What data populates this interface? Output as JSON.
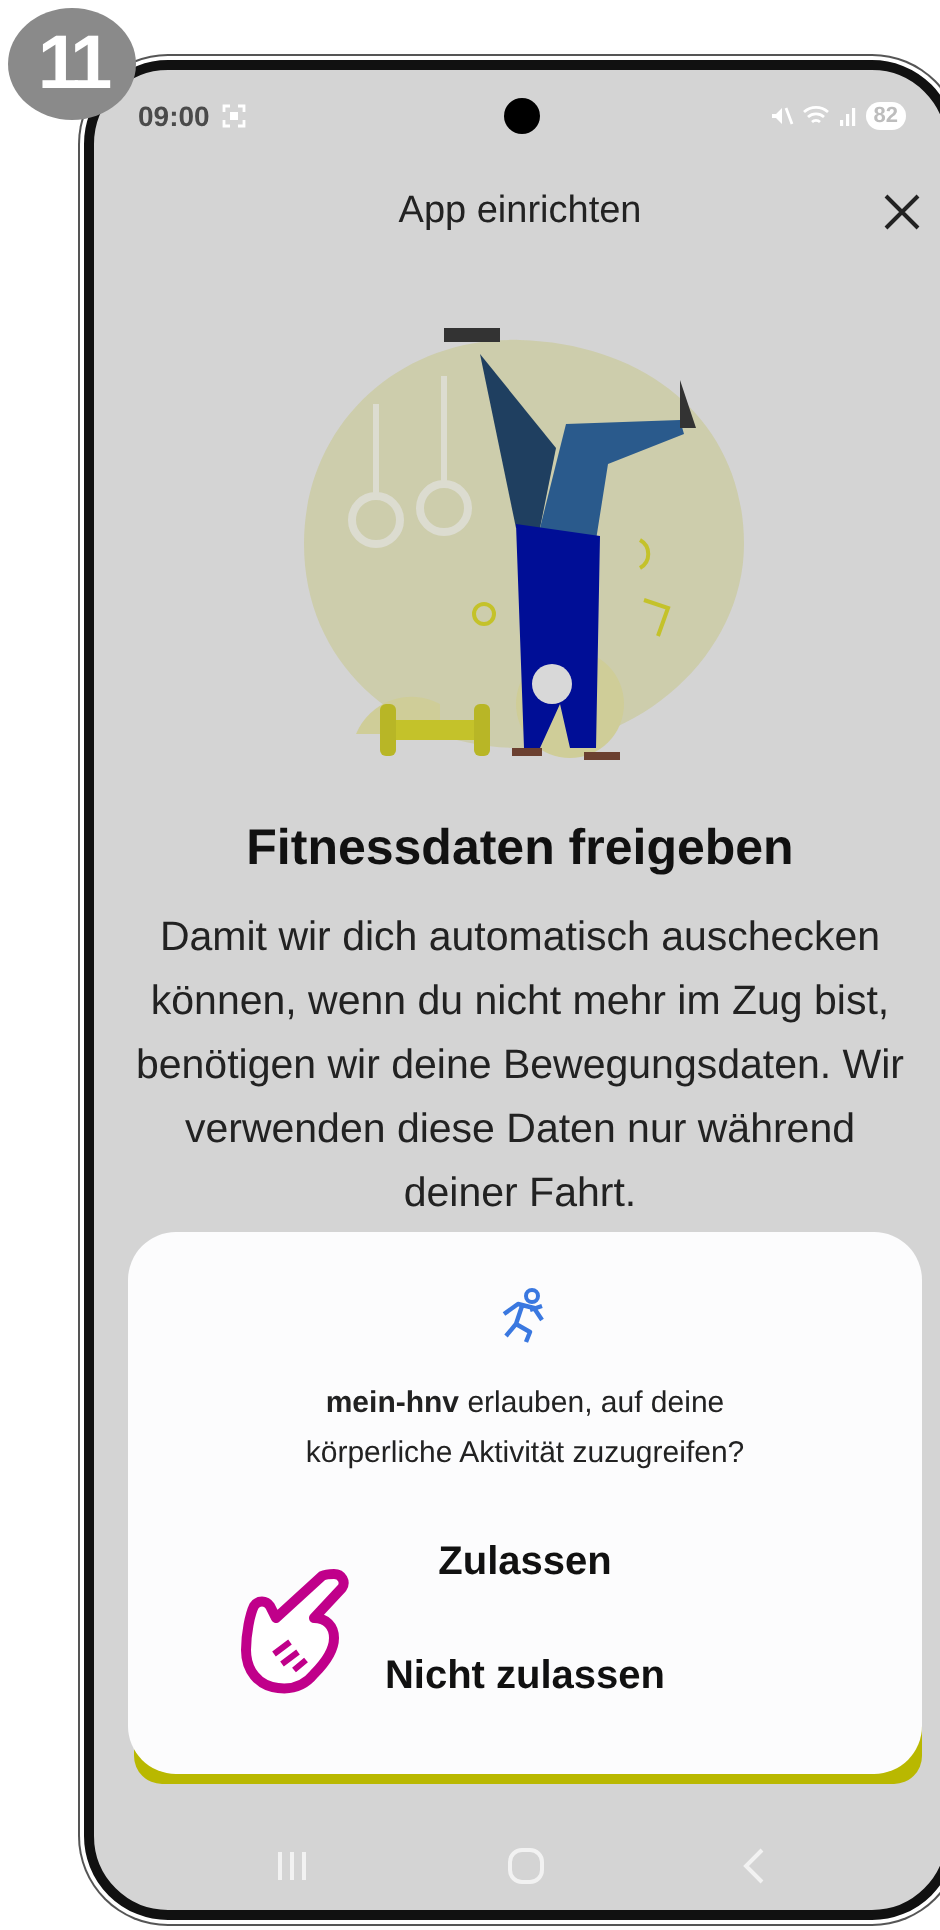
{
  "step_badge": "11",
  "status_bar": {
    "time": "09:00",
    "battery": "82"
  },
  "header": {
    "title": "App einrichten"
  },
  "heading": "Fitnessdaten freigeben",
  "body": "Damit wir dich automatisch auschecken können, wenn du nicht mehr im Zug bist, benötigen wir deine Bewegungsdaten. Wir verwenden diese Daten nur während deiner Fahrt.",
  "dialog": {
    "message": "**mein-hnv** erlauben, auf deine körperliche Aktivität zuzugreifen?",
    "buttons": [
      {
        "label": "Zulassen",
        "kind": "primary"
      },
      {
        "label": "Nicht zulassen",
        "kind": "secondary"
      }
    ]
  }
}
